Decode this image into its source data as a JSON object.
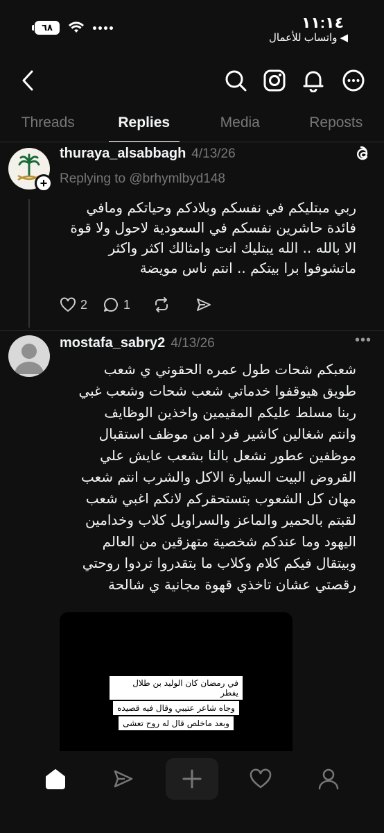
{
  "status_bar": {
    "time": "١١:١٤",
    "back_app": "واتساب للأعمال",
    "battery": "٦٨"
  },
  "header": {
    "back_icon": "chevron-left-icon",
    "icons": [
      "search-icon",
      "instagram-icon",
      "bell-icon",
      "more-icon"
    ]
  },
  "tabs": [
    {
      "label": "Threads",
      "active": false
    },
    {
      "label": "Replies",
      "active": true
    },
    {
      "label": "Media",
      "active": false
    },
    {
      "label": "Reposts",
      "active": false
    }
  ],
  "post1": {
    "username": "thuraya_alsabbagh",
    "date": "4/13/26",
    "replying": "Replying to @brhymlbyd148",
    "lines": [
      "ربي مبتليكم في نفسكم وبلادكم وحياتكم ومافي",
      "فائدة حاشرين نفسكم في السعودية لاحول ولا قوة",
      "الا بالله .. الله يبتليك انت وامثالك اكثر واكثر",
      "ماتشوفوا برا بيتكم .. انتم ناس مويضة"
    ],
    "likes": "2",
    "comments": "1"
  },
  "post2": {
    "username": "mostafa_sabry2",
    "date": "4/13/26",
    "lines": [
      "شعبكم شحات طول عمره الحقوني ي شعب",
      "طويق هيوقفوا خدماتي شعب شحات وشعب غبي",
      "ربنا مسلط عليكم المقيمين واخذين الوظايف",
      "وانتم شغالين كاشير فرد امن موظف استقبال",
      "موظفين عطور نشعل بالنا بشعب عايش علي",
      "القروض البيت السيارة الاكل والشرب انتم شعب",
      "مهان كل الشعوب بتستحقركم لانكم اغبي شعب",
      "لقبتم بالحمير والماعز والسراويل كلاب وخدامين",
      "اليهود وما عندكم شخصية متهزقين من العالم",
      "وبيتقال فيكم كلام وكلاب ما بتقدروا تردوا روحتي",
      "رقصتي عشان تاخذي قهوة مجانية ي شالحة"
    ],
    "media_caption": [
      "في رمضان كان الوليد بن طلال يفطر",
      "وجاه شاعر عتيبي وقال فيه قصيده",
      "وبعد ماخلص قال له روح تعشى"
    ]
  },
  "bottom_nav": [
    "home-icon",
    "send-icon",
    "add-icon",
    "heart-icon",
    "profile-icon"
  ]
}
